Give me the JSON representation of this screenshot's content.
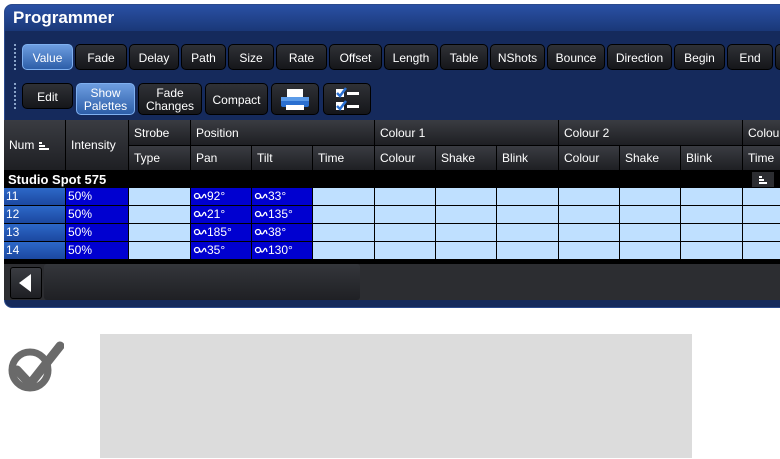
{
  "window": {
    "title": "Programmer"
  },
  "toolbar1": {
    "buttons": [
      "Value",
      "Fade",
      "Delay",
      "Path",
      "Size",
      "Rate",
      "Offset",
      "Length",
      "Table",
      "NShots",
      "Bounce",
      "Direction",
      "Begin",
      "End"
    ]
  },
  "toolbar2": {
    "edit": "Edit",
    "show_palettes": [
      "Show",
      "Palettes"
    ],
    "fade_changes": [
      "Fade",
      "Changes"
    ],
    "compact": "Compact"
  },
  "headers": {
    "num": "Num",
    "intensity": "Intensity",
    "strobe": "Strobe",
    "strobe_type": "Type",
    "position": "Position",
    "pan": "Pan",
    "tilt": "Tilt",
    "time": "Time",
    "colour1": "Colour 1",
    "colour2": "Colour 2",
    "colour3": "Colou",
    "colour": "Colour",
    "shake": "Shake",
    "blink": "Blink",
    "time2": "Time"
  },
  "group": {
    "name": "Studio Spot 575"
  },
  "rows": [
    {
      "num": "11",
      "intensity": "50%",
      "pan": "92°",
      "tilt": "33°"
    },
    {
      "num": "12",
      "intensity": "50%",
      "pan": "21°",
      "tilt": "135°"
    },
    {
      "num": "13",
      "intensity": "50%",
      "pan": "185°",
      "tilt": "38°"
    },
    {
      "num": "14",
      "intensity": "50%",
      "pan": "35°",
      "tilt": "130°"
    }
  ],
  "colors": {
    "selected_cell": "#0000d0",
    "empty_cell": "#bfe0ff",
    "active_button": "#4a80cc",
    "title_bar": "#1f3f8a"
  }
}
